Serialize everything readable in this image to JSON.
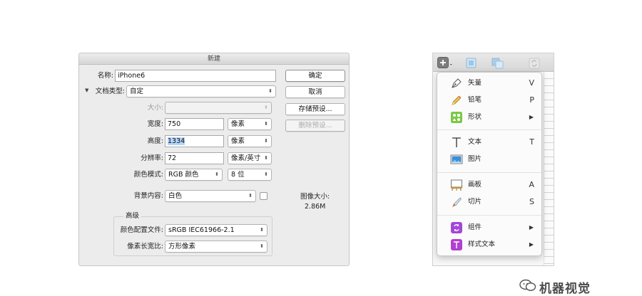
{
  "ps_dialog": {
    "title": "新建",
    "name": {
      "label": "名称:",
      "value": "iPhone6"
    },
    "preset": {
      "label": "文档类型:",
      "value": "自定"
    },
    "size": {
      "label": "大小:",
      "value": ""
    },
    "width": {
      "label": "宽度:",
      "value": "750",
      "unit": "像素"
    },
    "height": {
      "label": "高度:",
      "value": "1334",
      "unit": "像素"
    },
    "resolution": {
      "label": "分辨率:",
      "value": "72",
      "unit": "像素/英寸"
    },
    "color_mode": {
      "label": "颜色模式:",
      "value": "RGB 颜色",
      "depth": "8 位"
    },
    "background": {
      "label": "背景内容:",
      "value": "白色"
    },
    "advanced": {
      "title": "高级",
      "color_profile": {
        "label": "颜色配置文件:",
        "value": "sRGB IEC61966-2.1"
      },
      "pixel_aspect": {
        "label": "像素长宽比:",
        "value": "方形像素"
      }
    },
    "buttons": {
      "ok": "确定",
      "cancel": "取消",
      "save_preset": "存储预设...",
      "delete_preset": "删除预设..."
    },
    "image_size": {
      "label": "图像大小:",
      "value": "2.86M"
    }
  },
  "sketch_menu": {
    "items": [
      {
        "label": "矢量",
        "shortcut": "V",
        "icon": "vector-pen-icon"
      },
      {
        "label": "铅笔",
        "shortcut": "P",
        "icon": "pencil-icon"
      },
      {
        "label": "形状",
        "submenu": "▶",
        "icon": "shape-icon"
      },
      {
        "label": "文本",
        "shortcut": "T",
        "icon": "text-icon"
      },
      {
        "label": "图片",
        "shortcut": "",
        "icon": "image-icon"
      },
      {
        "label": "画板",
        "shortcut": "A",
        "icon": "artboard-icon"
      },
      {
        "label": "切片",
        "shortcut": "S",
        "icon": "slice-knife-icon"
      },
      {
        "label": "组件",
        "submenu": "▶",
        "icon": "symbol-icon"
      },
      {
        "label": "样式文本",
        "submenu": "▶",
        "icon": "text-style-icon"
      }
    ],
    "colors": {
      "shape": "#7ac943",
      "symbol": "#a347d9",
      "text_style": "#b33fd0",
      "image": "#3b8ed6"
    }
  },
  "watermark": {
    "text": "机器视觉"
  }
}
